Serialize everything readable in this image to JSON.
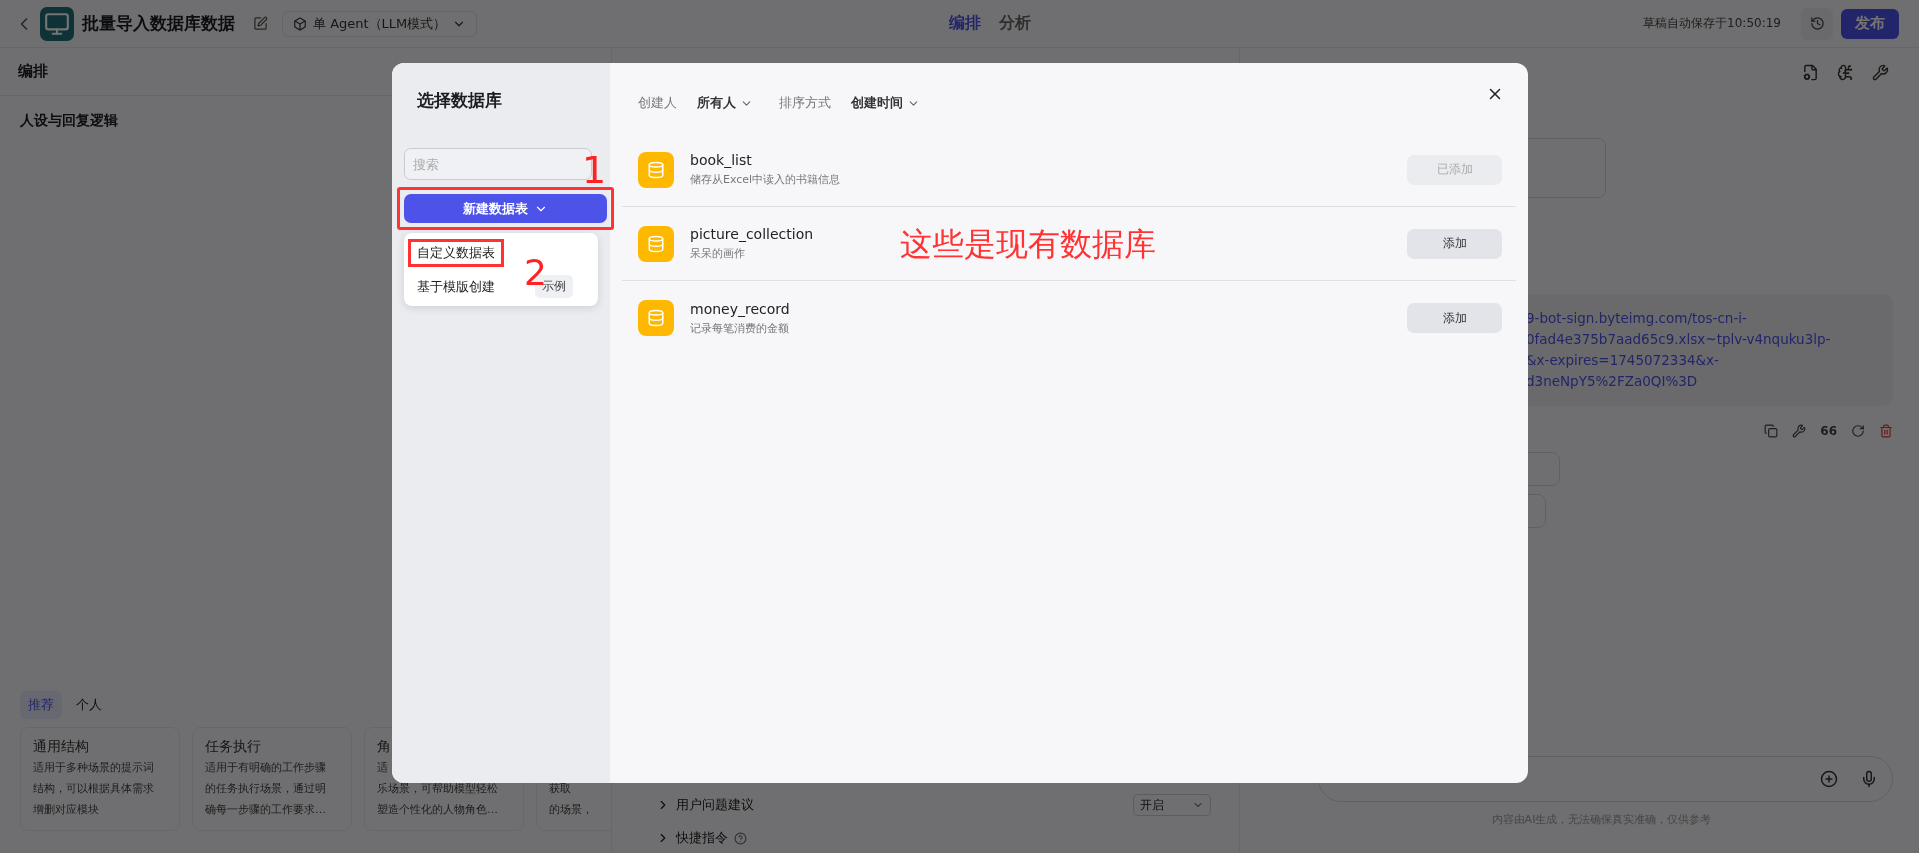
{
  "top_bar": {
    "title": "批量导入数据库数据",
    "mode": "单 Agent（LLM模式）",
    "tabs": [
      {
        "label": "编排",
        "selected": true
      },
      {
        "label": "分析",
        "selected": false
      }
    ],
    "autosave": "草稿自动保存于10:50:19",
    "publish": "发布"
  },
  "left_panel": {
    "header": "编排",
    "section": "人设与回复逻辑",
    "template_tabs": [
      {
        "label": "推荐",
        "selected": true
      },
      {
        "label": "个人",
        "selected": false
      }
    ],
    "template_cards": [
      {
        "title": "通用结构",
        "lines": [
          "适用于多种场景的提示词",
          "结构，可以根据具体需求",
          "增删对应模块"
        ]
      },
      {
        "title": "任务执行",
        "lines": [
          "适用于有明确的工作步骤",
          "的任务执行场景，通过明",
          "确每一步骤的工作要求…"
        ]
      },
      {
        "title": "角",
        "lines": [
          "适",
          "乐场景，可帮助模型轻松",
          "塑造个性化的人物角色…"
        ]
      },
      {
        "lines": [
          "获取",
          "的场景，"
        ]
      }
    ]
  },
  "middle_panel": {
    "settings": [
      {
        "label": "用户问题建议",
        "value": "开启"
      },
      {
        "label": "快捷指令"
      }
    ]
  },
  "preview": {
    "link_lines": [
      "9-bot-sign.byteimg.com/tos-cn-i-",
      "0fad4e375b7aad65c9.xlsx~tplv-v4nquku3lp-",
      "&x-expires=1745072334&x-",
      "d3neNpY5%2FZa0QI%3D"
    ],
    "quote_label": "66",
    "footer": "内容由AI生成，无法确保真实准确，仅供参考"
  },
  "dialog": {
    "title": "选择数据库",
    "search_placeholder": "搜索",
    "create_button": "新建数据表",
    "create_menu": [
      {
        "label": "自定义数据表"
      },
      {
        "label": "基于模版创建",
        "tag": "示例"
      }
    ],
    "filters": [
      {
        "label": "创建人",
        "value": "所有人"
      },
      {
        "label": "排序方式",
        "value": "创建时间"
      }
    ],
    "databases": [
      {
        "name": "book_list",
        "description": "储存从Excel中读入的书籍信息",
        "button": "已添加",
        "added": true
      },
      {
        "name": "picture_collection",
        "description": "呆呆的画作",
        "button": "添加",
        "added": false
      },
      {
        "name": "money_record",
        "description": "记录每笔消费的金额",
        "button": "添加",
        "added": false
      }
    ]
  },
  "annotations": {
    "step_marks": [
      "1",
      "2"
    ],
    "note": "这些是现有数据库"
  }
}
